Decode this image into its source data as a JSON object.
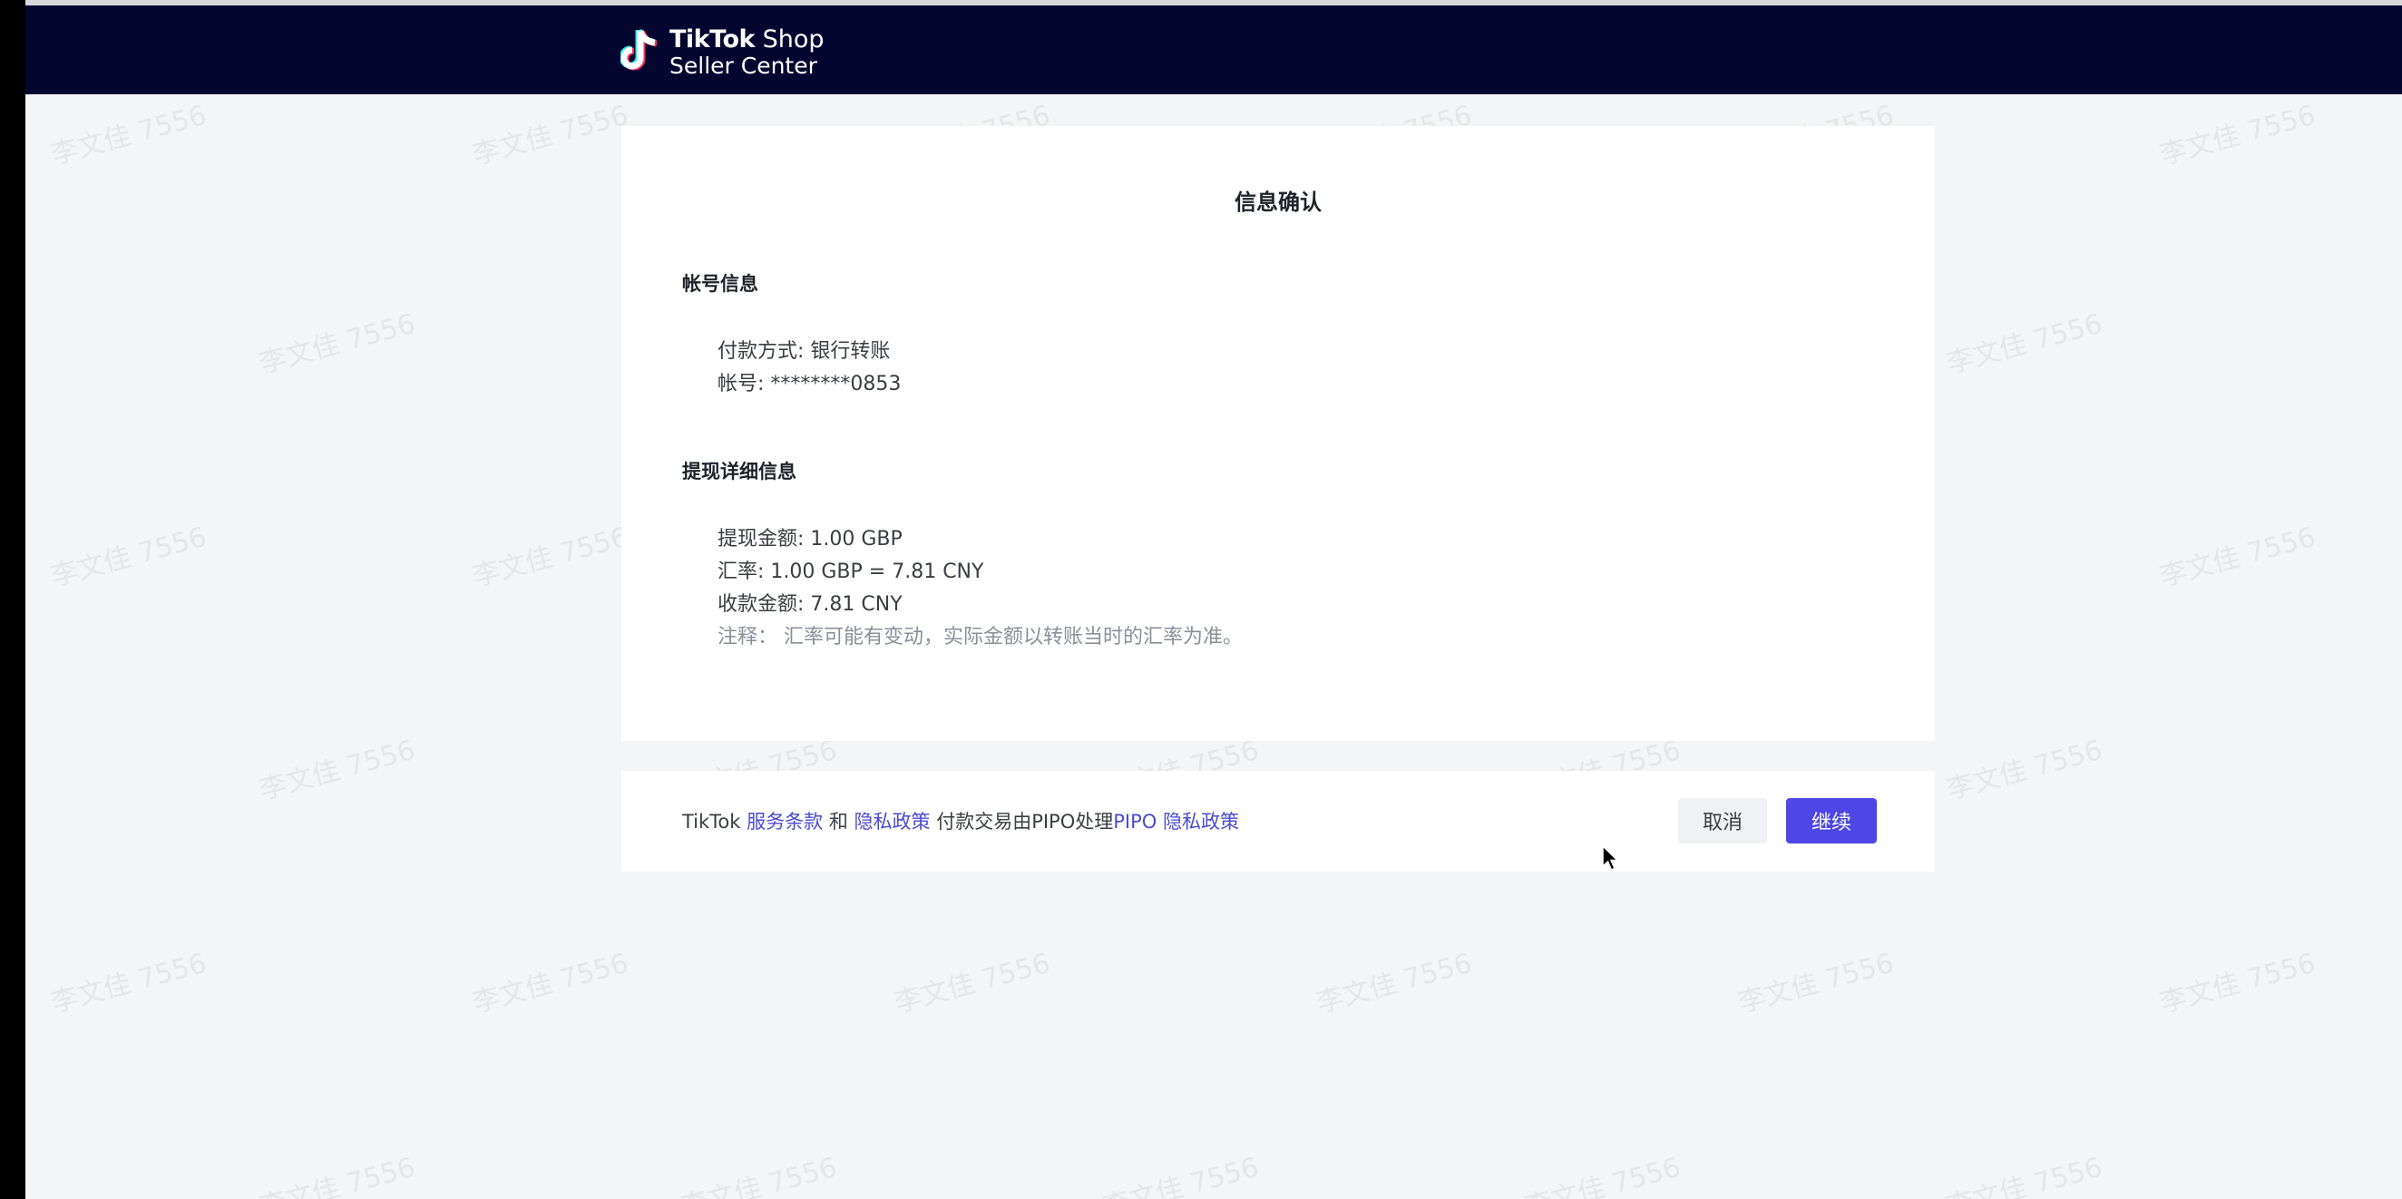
{
  "header": {
    "brand_bold": "TikTok",
    "brand_light": "Shop",
    "brand_sub": "Seller Center",
    "background": "#03062f"
  },
  "watermark": {
    "text": "李文佳 7556"
  },
  "card": {
    "title": "信息确认",
    "account_section": {
      "title": "帐号信息",
      "payment_method": "付款方式: 银行转账",
      "account_number": "帐号: ********0853"
    },
    "withdraw_section": {
      "title": "提现详细信息",
      "amount": "提现金额: 1.00 GBP",
      "rate": "汇率: 1.00 GBP = 7.81 CNY",
      "received": "收款金额: 7.81 CNY",
      "note": "注释：  汇率可能有变动，实际金额以转账当时的汇率为准。"
    }
  },
  "footer": {
    "prefix": "TikTok",
    "terms_link": "服务条款",
    "and": "和",
    "privacy_link": "隐私政策",
    "pipo_text": "付款交易由PIPO处理",
    "pipo_link": "PIPO 隐私政策",
    "cancel_label": "取消",
    "continue_label": "继续",
    "accent_color": "#4e46e5",
    "link_color": "#4d4ad1"
  }
}
